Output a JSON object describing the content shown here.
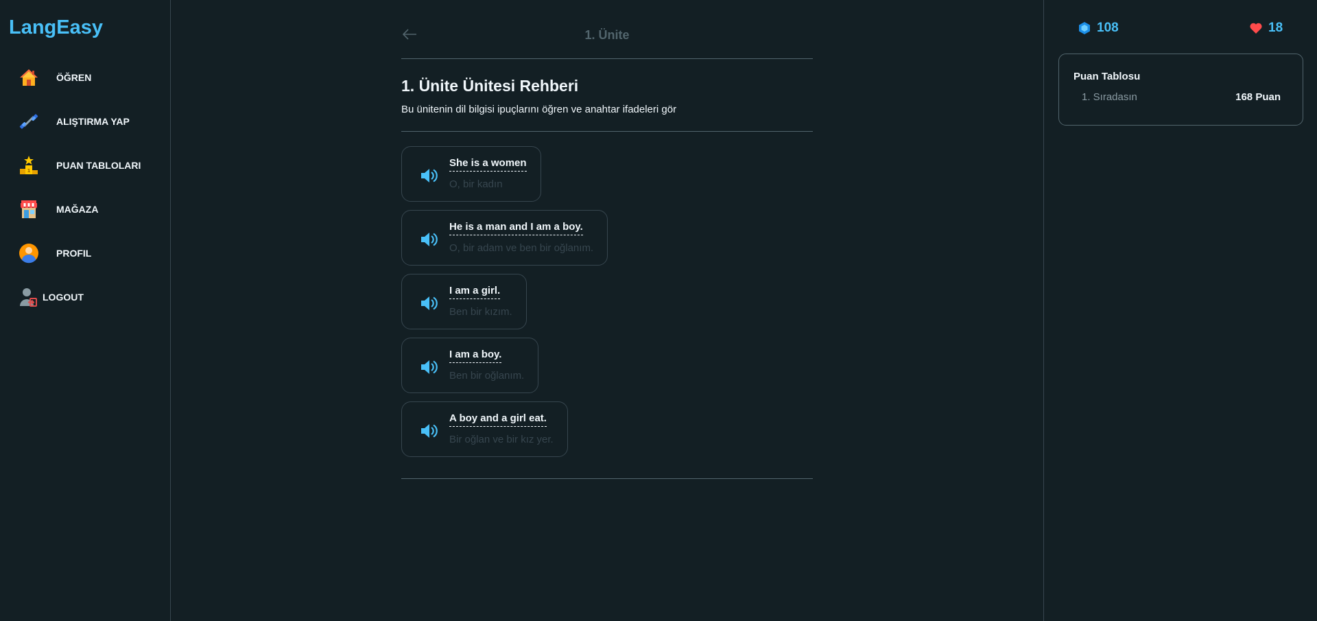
{
  "brand": "LangEasy",
  "nav": [
    {
      "label": "ÖĞREN",
      "icon": "house-icon"
    },
    {
      "label": "ALIŞTIRMA YAP",
      "icon": "dumbbell-icon"
    },
    {
      "label": "PUAN TABLOLARI",
      "icon": "podium-icon"
    },
    {
      "label": "MAĞAZA",
      "icon": "shop-icon"
    },
    {
      "label": "PROFIL",
      "icon": "profile-icon"
    },
    {
      "label": "LOGOUT",
      "icon": "logout-icon"
    }
  ],
  "header": {
    "unit_title": "1. Ünite"
  },
  "guide": {
    "title": "1. Ünite Ünitesi Rehberi",
    "subtitle": "Bu ünitenin dil bilgisi ipuçlarını öğren ve anahtar ifadeleri gör"
  },
  "phrases": [
    {
      "en": "She is a women",
      "tr": "O, bir kadın"
    },
    {
      "en": "He is a man and I am a boy.",
      "tr": "O, bir adam ve ben bir oğlanım."
    },
    {
      "en": "I am a girl.",
      "tr": "Ben bir kızım."
    },
    {
      "en": "I am a boy.",
      "tr": "Ben bir oğlanım."
    },
    {
      "en": "A boy and a girl eat.",
      "tr": "Bir oğlan ve bir kız yer."
    }
  ],
  "stats": {
    "gems": "108",
    "hearts": "18"
  },
  "leaderboard": {
    "title": "Puan Tablosu",
    "rank": "1. Sıradasın",
    "points": "168 Puan"
  },
  "colors": {
    "background": "#131f24",
    "accent": "#49c0f8",
    "border": "#37464f",
    "muted": "#52656d"
  }
}
